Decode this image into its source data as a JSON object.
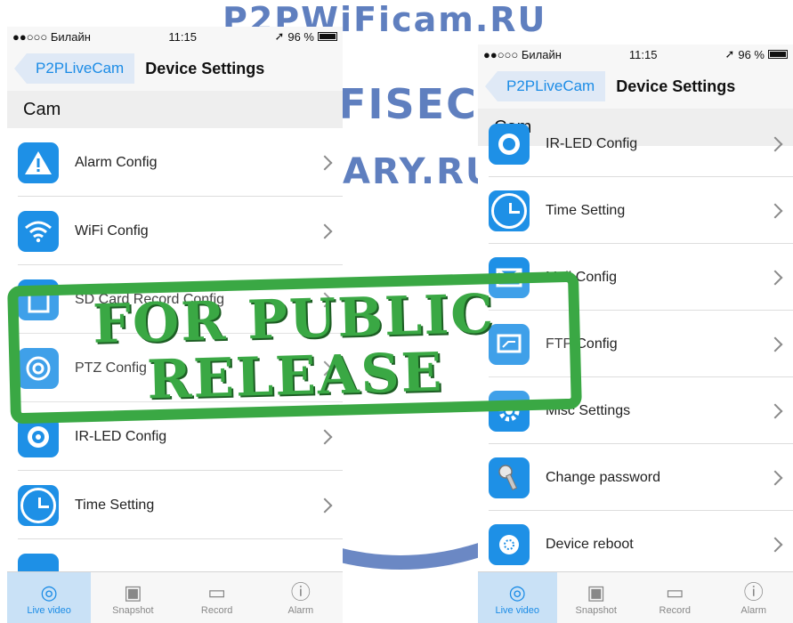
{
  "watermark": {
    "line1": "P2PWiFicam.RU",
    "line2": "FISEC.",
    "line3": "ARY.RU"
  },
  "left_phone": {
    "status": {
      "carrier": "●●○○○ Билайн",
      "time": "11:15",
      "battery": "96 %"
    },
    "nav": {
      "back_label": "P2PLiveCam",
      "title": "Device Settings"
    },
    "section": "Cam",
    "items": [
      {
        "label": "Alarm Config",
        "icon": "warning-icon"
      },
      {
        "label": "WiFi Config",
        "icon": "wifi-icon"
      },
      {
        "label": "SD Card Record Config",
        "icon": "sd-card-icon"
      },
      {
        "label": "PTZ Config",
        "icon": "ptz-icon"
      },
      {
        "label": "IR-LED Config",
        "icon": "ir-led-icon"
      },
      {
        "label": "Time Setting",
        "icon": "clock-icon"
      }
    ]
  },
  "right_phone": {
    "status": {
      "carrier": "●●○○○ Билайн",
      "time": "11:15",
      "battery": "96 %"
    },
    "nav": {
      "back_label": "P2PLiveCam",
      "title": "Device Settings"
    },
    "section": "Cam",
    "items": [
      {
        "label": "IR-LED Config",
        "icon": "ir-led-icon"
      },
      {
        "label": "Time Setting",
        "icon": "clock-icon"
      },
      {
        "label": "Mail Config",
        "icon": "mail-icon"
      },
      {
        "label": "FTP Config",
        "icon": "ftp-icon"
      },
      {
        "label": "Misc Settings",
        "icon": "gear-icon"
      },
      {
        "label": "Change password",
        "icon": "key-icon"
      },
      {
        "label": "Device reboot",
        "icon": "reboot-icon"
      }
    ]
  },
  "tabs": [
    {
      "label": "Live video",
      "icon": "live-video-icon"
    },
    {
      "label": "Snapshot",
      "icon": "snapshot-icon"
    },
    {
      "label": "Record",
      "icon": "record-icon"
    },
    {
      "label": "Alarm",
      "icon": "alarm-icon"
    }
  ],
  "stamp": {
    "line1": "FOR PUBLIC",
    "line2": "RELEASE"
  },
  "colors": {
    "accent": "#1e90e6",
    "stamp": "#3aa844",
    "watermark": "#5f7fbf"
  }
}
